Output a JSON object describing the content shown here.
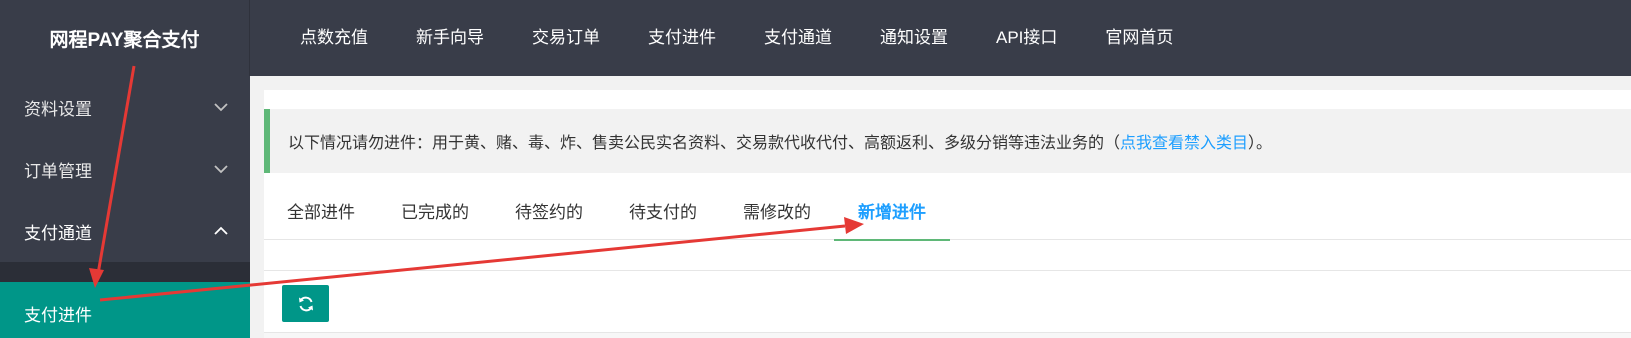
{
  "logo": {
    "title": "网程PAY聚合支付"
  },
  "top_nav": [
    {
      "label": "点数充值"
    },
    {
      "label": "新手向导"
    },
    {
      "label": "交易订单"
    },
    {
      "label": "支付进件"
    },
    {
      "label": "支付通道"
    },
    {
      "label": "通知设置"
    },
    {
      "label": "API接口"
    },
    {
      "label": "官网首页"
    }
  ],
  "sidebar": {
    "items": [
      {
        "label": "资料设置",
        "state": "collapsed"
      },
      {
        "label": "订单管理",
        "state": "collapsed"
      },
      {
        "label": "支付通道",
        "state": "expanded"
      }
    ],
    "active_sub": {
      "label": "支付进件"
    }
  },
  "notice": {
    "text": "以下情况请勿进件：用于黄、赌、毒、炸、售卖公民实名资料、交易款代收代付、高额返利、多级分销等违法业务的（",
    "link": "点我查看禁入类目",
    "suffix": "）。"
  },
  "tabs": [
    {
      "label": "全部进件",
      "active": false
    },
    {
      "label": "已完成的",
      "active": false
    },
    {
      "label": "待签约的",
      "active": false
    },
    {
      "label": "待支付的",
      "active": false
    },
    {
      "label": "需修改的",
      "active": false
    },
    {
      "label": "新增进件",
      "active": true
    }
  ],
  "toolbar": {
    "refresh_icon": "refresh-icon"
  },
  "colors": {
    "topbar": "#393d49",
    "active_green": "#009688",
    "link_blue": "#1e9fff",
    "notice_border": "#5fb878",
    "annotation_red": "#e53935"
  }
}
